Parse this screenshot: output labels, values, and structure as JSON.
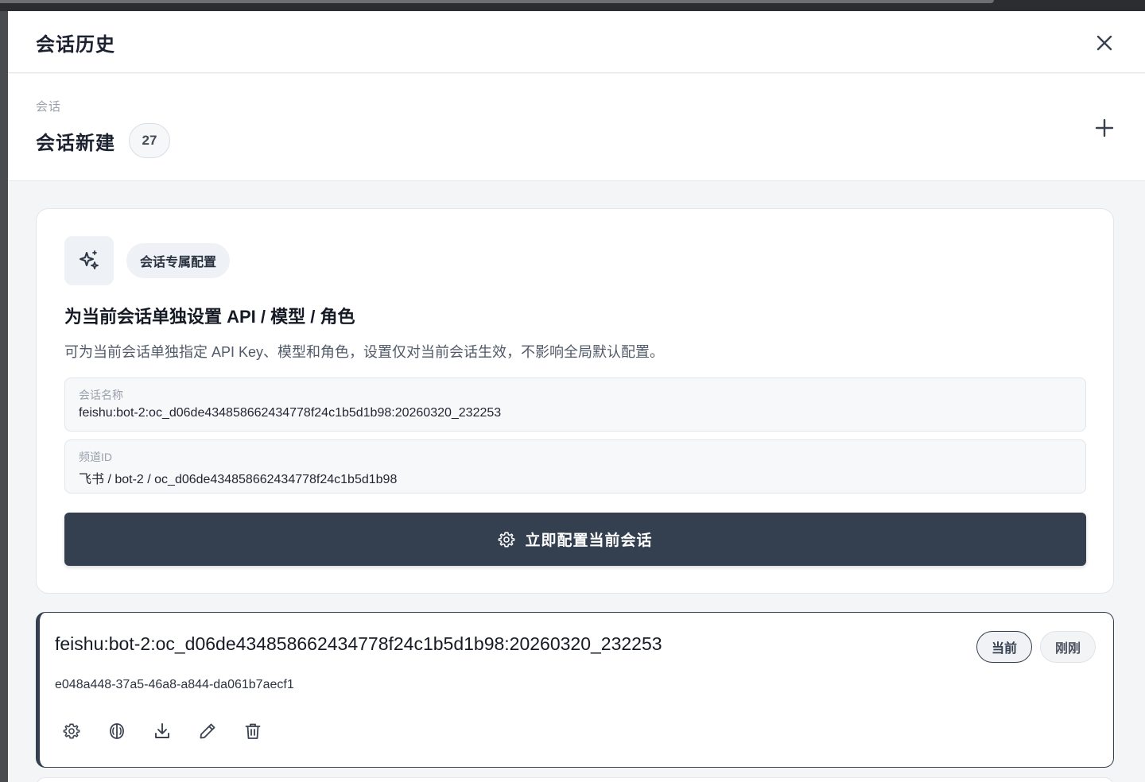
{
  "panel": {
    "title": "会话历史",
    "close_icon": "close-icon"
  },
  "section": {
    "label": "会话",
    "title": "会话新建",
    "count": "27",
    "add_icon": "plus-icon"
  },
  "config_card": {
    "icon": "sparkles-icon",
    "tag": "会话专属配置",
    "heading": "为当前会话单独设置 API / 模型 / 角色",
    "description": "可为当前会话单独指定 API Key、模型和角色，设置仅对当前会话生效，不影响全局默认配置。",
    "fields": [
      {
        "label": "会话名称",
        "value": "feishu:bot-2:oc_d06de434858662434778f24c1b5d1b98:20260320_232253"
      },
      {
        "label": "频道ID",
        "value": "飞书 / bot-2 / oc_d06de434858662434778f24c1b5d1b98"
      }
    ],
    "button_label": "立即配置当前会话",
    "button_icon": "gear-icon",
    "button_color": "#343f4f"
  },
  "session": {
    "name": "feishu:bot-2:oc_d06de434858662434778f24c1b5d1b98:20260320_232253",
    "id": "e048a448-37a5-46a8-a844-da061b7aecf1",
    "badge_current": "当前",
    "badge_time": "刚刚",
    "actions": [
      "gear-icon",
      "brain-icon",
      "download-icon",
      "pencil-icon",
      "trash-icon"
    ]
  }
}
